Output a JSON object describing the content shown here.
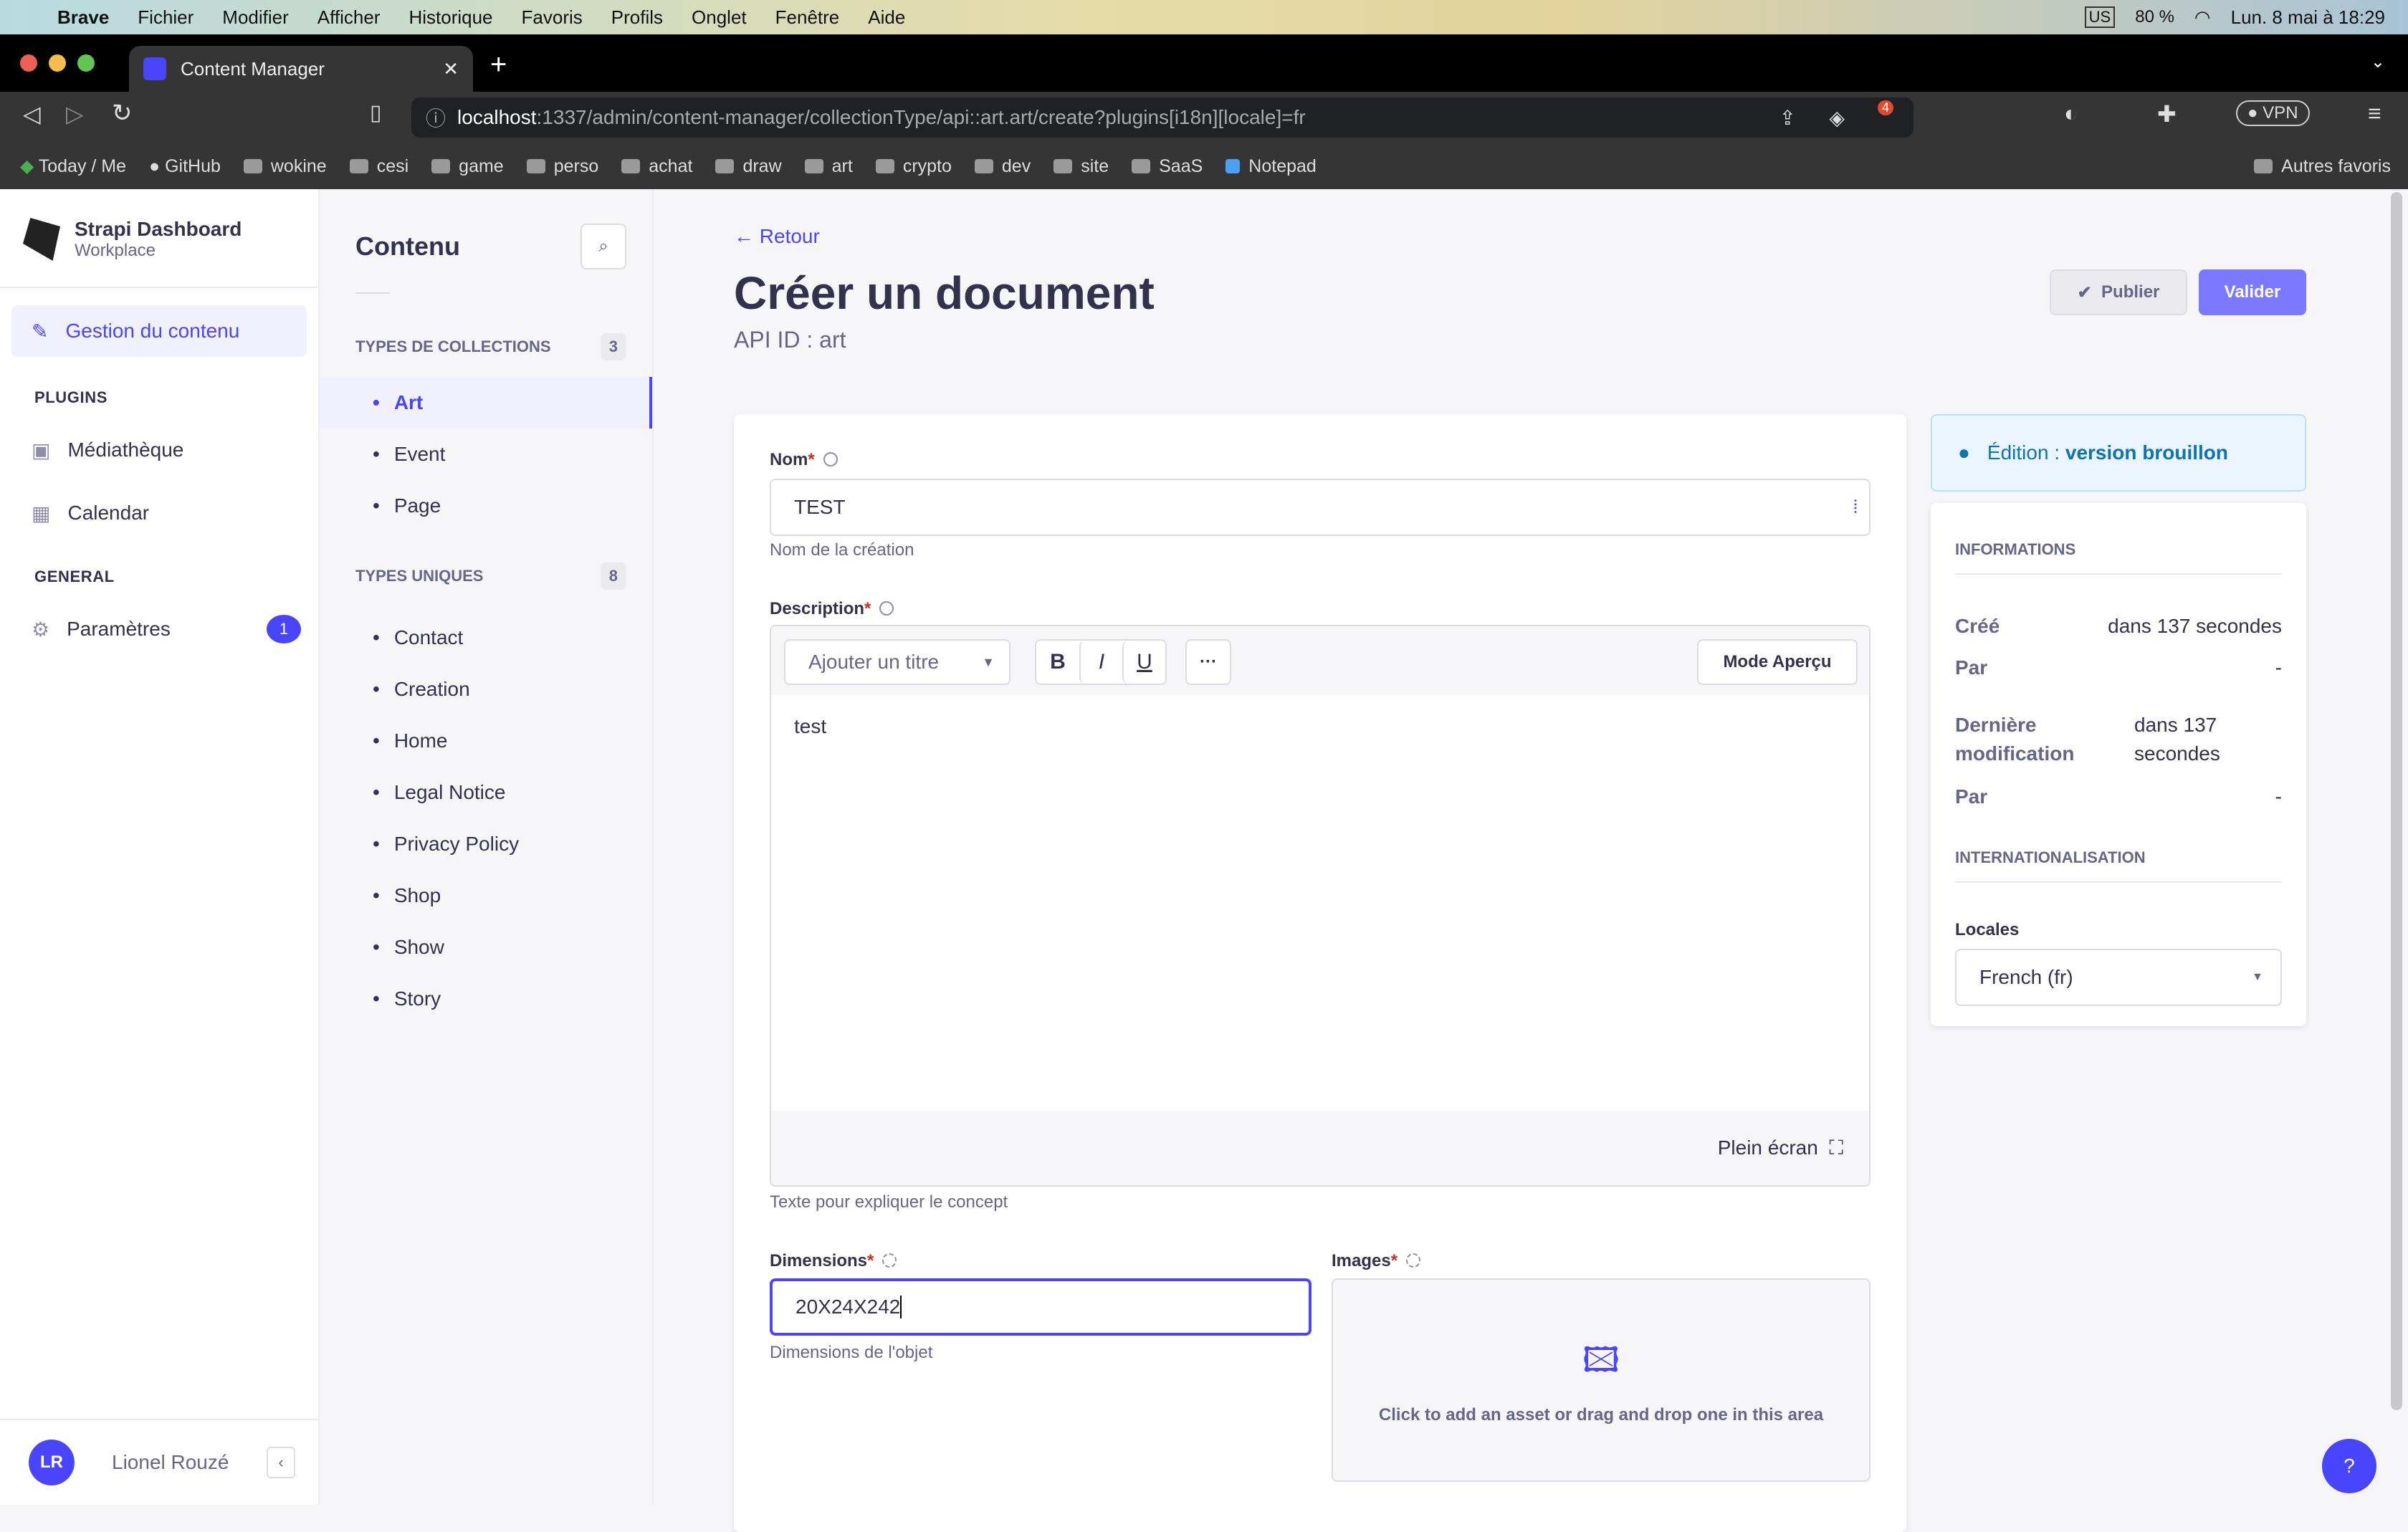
{
  "menubar": {
    "app": "Brave",
    "items": [
      "Fichier",
      "Modifier",
      "Afficher",
      "Historique",
      "Favoris",
      "Profils",
      "Onglet",
      "Fenêtre",
      "Aide"
    ],
    "battery": "80 %",
    "keyboard": "US",
    "datetime": "Lun. 8 mai à 18:29"
  },
  "browser": {
    "tab_title": "Content Manager",
    "url_host": "localhost",
    "url_rest": ":1337/admin/content-manager/collectionType/api::art.art/create?plugins[i18n][locale]=fr",
    "vpn": "VPN",
    "brave_badge": "4",
    "bookmarks": [
      "Today / Me",
      "GitHub",
      "wokine",
      "cesi",
      "game",
      "perso",
      "achat",
      "draw",
      "art",
      "crypto",
      "dev",
      "site",
      "SaaS",
      "Notepad"
    ],
    "other_bookmarks": "Autres favoris"
  },
  "nav": {
    "title": "Strapi Dashboard",
    "subtitle": "Workplace",
    "content_manager": "Gestion du contenu",
    "plugins_heading": "PLUGINS",
    "media": "Médiathèque",
    "calendar": "Calendar",
    "general_heading": "GENERAL",
    "settings": "Paramètres",
    "settings_badge": "1",
    "user_initials": "LR",
    "user_name": "Lionel Rouzé"
  },
  "subnav": {
    "title": "Contenu",
    "collections_heading": "TYPES DE COLLECTIONS",
    "collections_count": "3",
    "collections": [
      "Art",
      "Event",
      "Page"
    ],
    "singles_heading": "TYPES UNIQUES",
    "singles_count": "8",
    "singles": [
      "Contact",
      "Creation",
      "Home",
      "Legal Notice",
      "Privacy Policy",
      "Shop",
      "Show",
      "Story"
    ]
  },
  "header": {
    "back": "Retour",
    "title": "Créer un document",
    "api_id": "API ID : art",
    "publish": "Publier",
    "save": "Valider"
  },
  "form": {
    "name_label": "Nom",
    "name_value": "TEST",
    "name_hint": "Nom de la création",
    "desc_label": "Description",
    "heading_select": "Ajouter un titre",
    "bold": "B",
    "italic": "I",
    "underline": "U",
    "more": "···",
    "preview_mode": "Mode Aperçu",
    "desc_value": "test",
    "fullscreen": "Plein écran",
    "desc_hint": "Texte pour expliquer le concept",
    "dim_label": "Dimensions",
    "dim_value": "20X24X242",
    "dim_hint": "Dimensions de l'objet",
    "images_label": "Images",
    "images_hint": "Click to add an asset or drag and drop one in this area"
  },
  "side": {
    "status_prefix": "Édition : ",
    "status_value": "version brouillon",
    "info_heading": "INFORMATIONS",
    "created_label": "Créé",
    "created_value": "dans 137 secondes",
    "by_label": "Par",
    "by_value": "-",
    "modified_label": "Dernière modification",
    "modified_value": "dans 137 secondes",
    "by2_label": "Par",
    "by2_value": "-",
    "i18n_heading": "INTERNATIONALISATION",
    "locales_label": "Locales",
    "locale_value": "French (fr)"
  },
  "help": "?"
}
